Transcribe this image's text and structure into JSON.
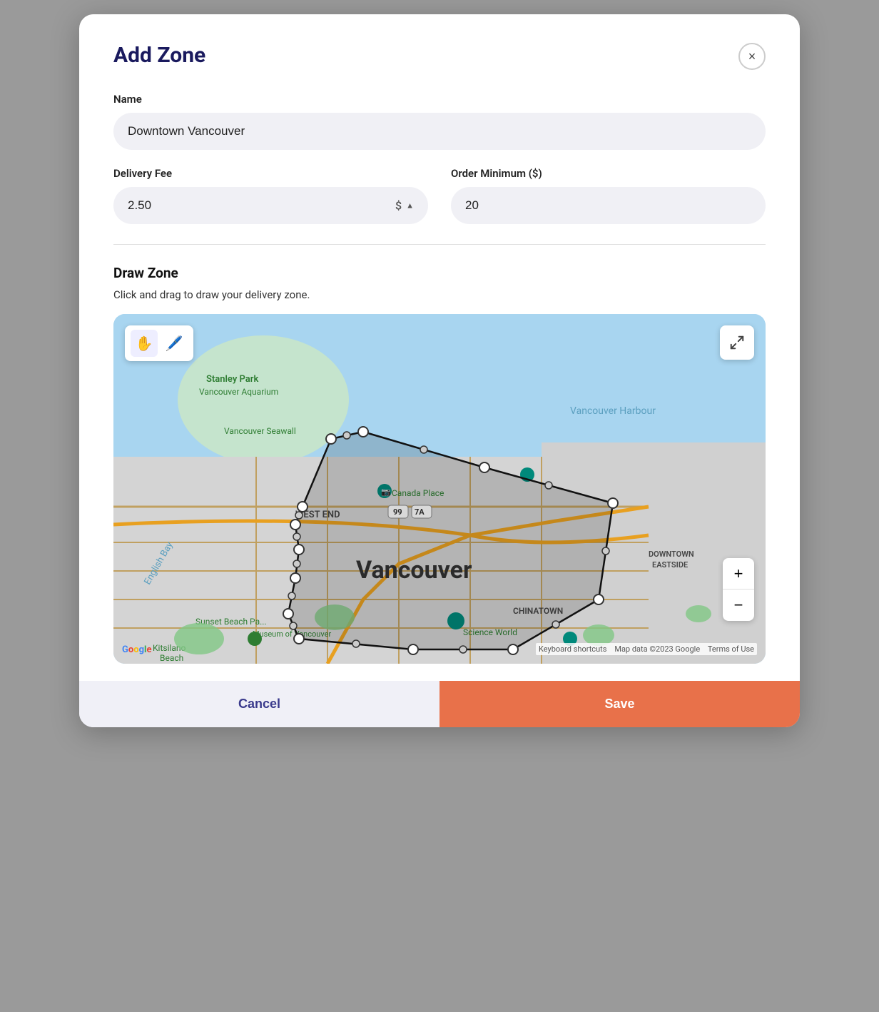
{
  "modal": {
    "title": "Add Zone",
    "close_label": "×"
  },
  "form": {
    "name_label": "Name",
    "name_value": "Downtown Vancouver",
    "name_placeholder": "Downtown Vancouver",
    "delivery_fee_label": "Delivery Fee",
    "delivery_fee_value": "2.50",
    "delivery_fee_currency": "$",
    "order_minimum_label": "Order Minimum ($)",
    "order_minimum_value": "20"
  },
  "draw_zone": {
    "title": "Draw Zone",
    "description": "Click and drag to draw your delivery zone."
  },
  "map": {
    "keyboard_shortcuts": "Keyboard shortcuts",
    "map_data": "Map data ©2023 Google",
    "terms": "Terms of Use"
  },
  "footer": {
    "cancel_label": "Cancel",
    "save_label": "Save"
  },
  "toolbar": {
    "hand_icon": "✋",
    "draw_icon": "✏️"
  },
  "zoom": {
    "plus": "+",
    "minus": "−"
  }
}
